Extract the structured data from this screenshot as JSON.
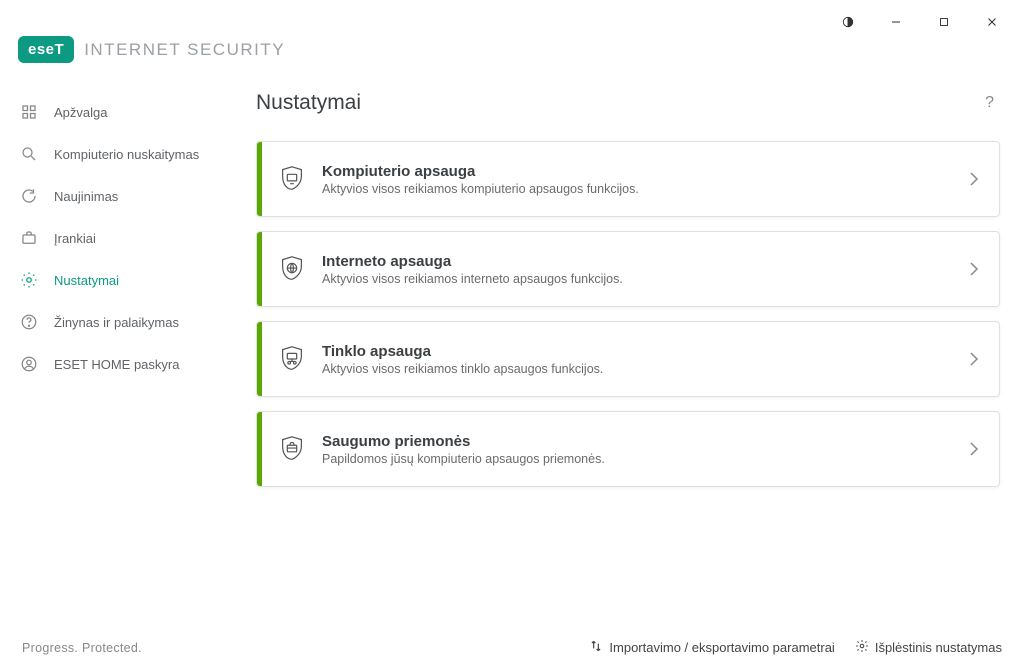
{
  "window": {
    "logo": "eseT",
    "product": "INTERNET SECURITY"
  },
  "sidebar": {
    "items": [
      {
        "label": "Apžvalga"
      },
      {
        "label": "Kompiuterio nuskaitymas"
      },
      {
        "label": "Naujinimas"
      },
      {
        "label": "Įrankiai"
      },
      {
        "label": "Nustatymai"
      },
      {
        "label": "Žinynas ir palaikymas"
      },
      {
        "label": "ESET HOME paskyra"
      }
    ]
  },
  "main": {
    "title": "Nustatymai",
    "cards": [
      {
        "title": "Kompiuterio apsauga",
        "subtitle": "Aktyvios visos reikiamos kompiuterio apsaugos funkcijos."
      },
      {
        "title": "Interneto apsauga",
        "subtitle": "Aktyvios visos reikiamos interneto apsaugos funkcijos."
      },
      {
        "title": "Tinklo apsauga",
        "subtitle": "Aktyvios visos reikiamos tinklo apsaugos funkcijos."
      },
      {
        "title": "Saugumo priemonės",
        "subtitle": "Papildomos jūsų kompiuterio apsaugos priemonės."
      }
    ]
  },
  "footer": {
    "tagline": "Progress. Protected.",
    "import_export": "Importavimo / eksportavimo parametrai",
    "advanced": "Išplėstinis nustatymas"
  }
}
